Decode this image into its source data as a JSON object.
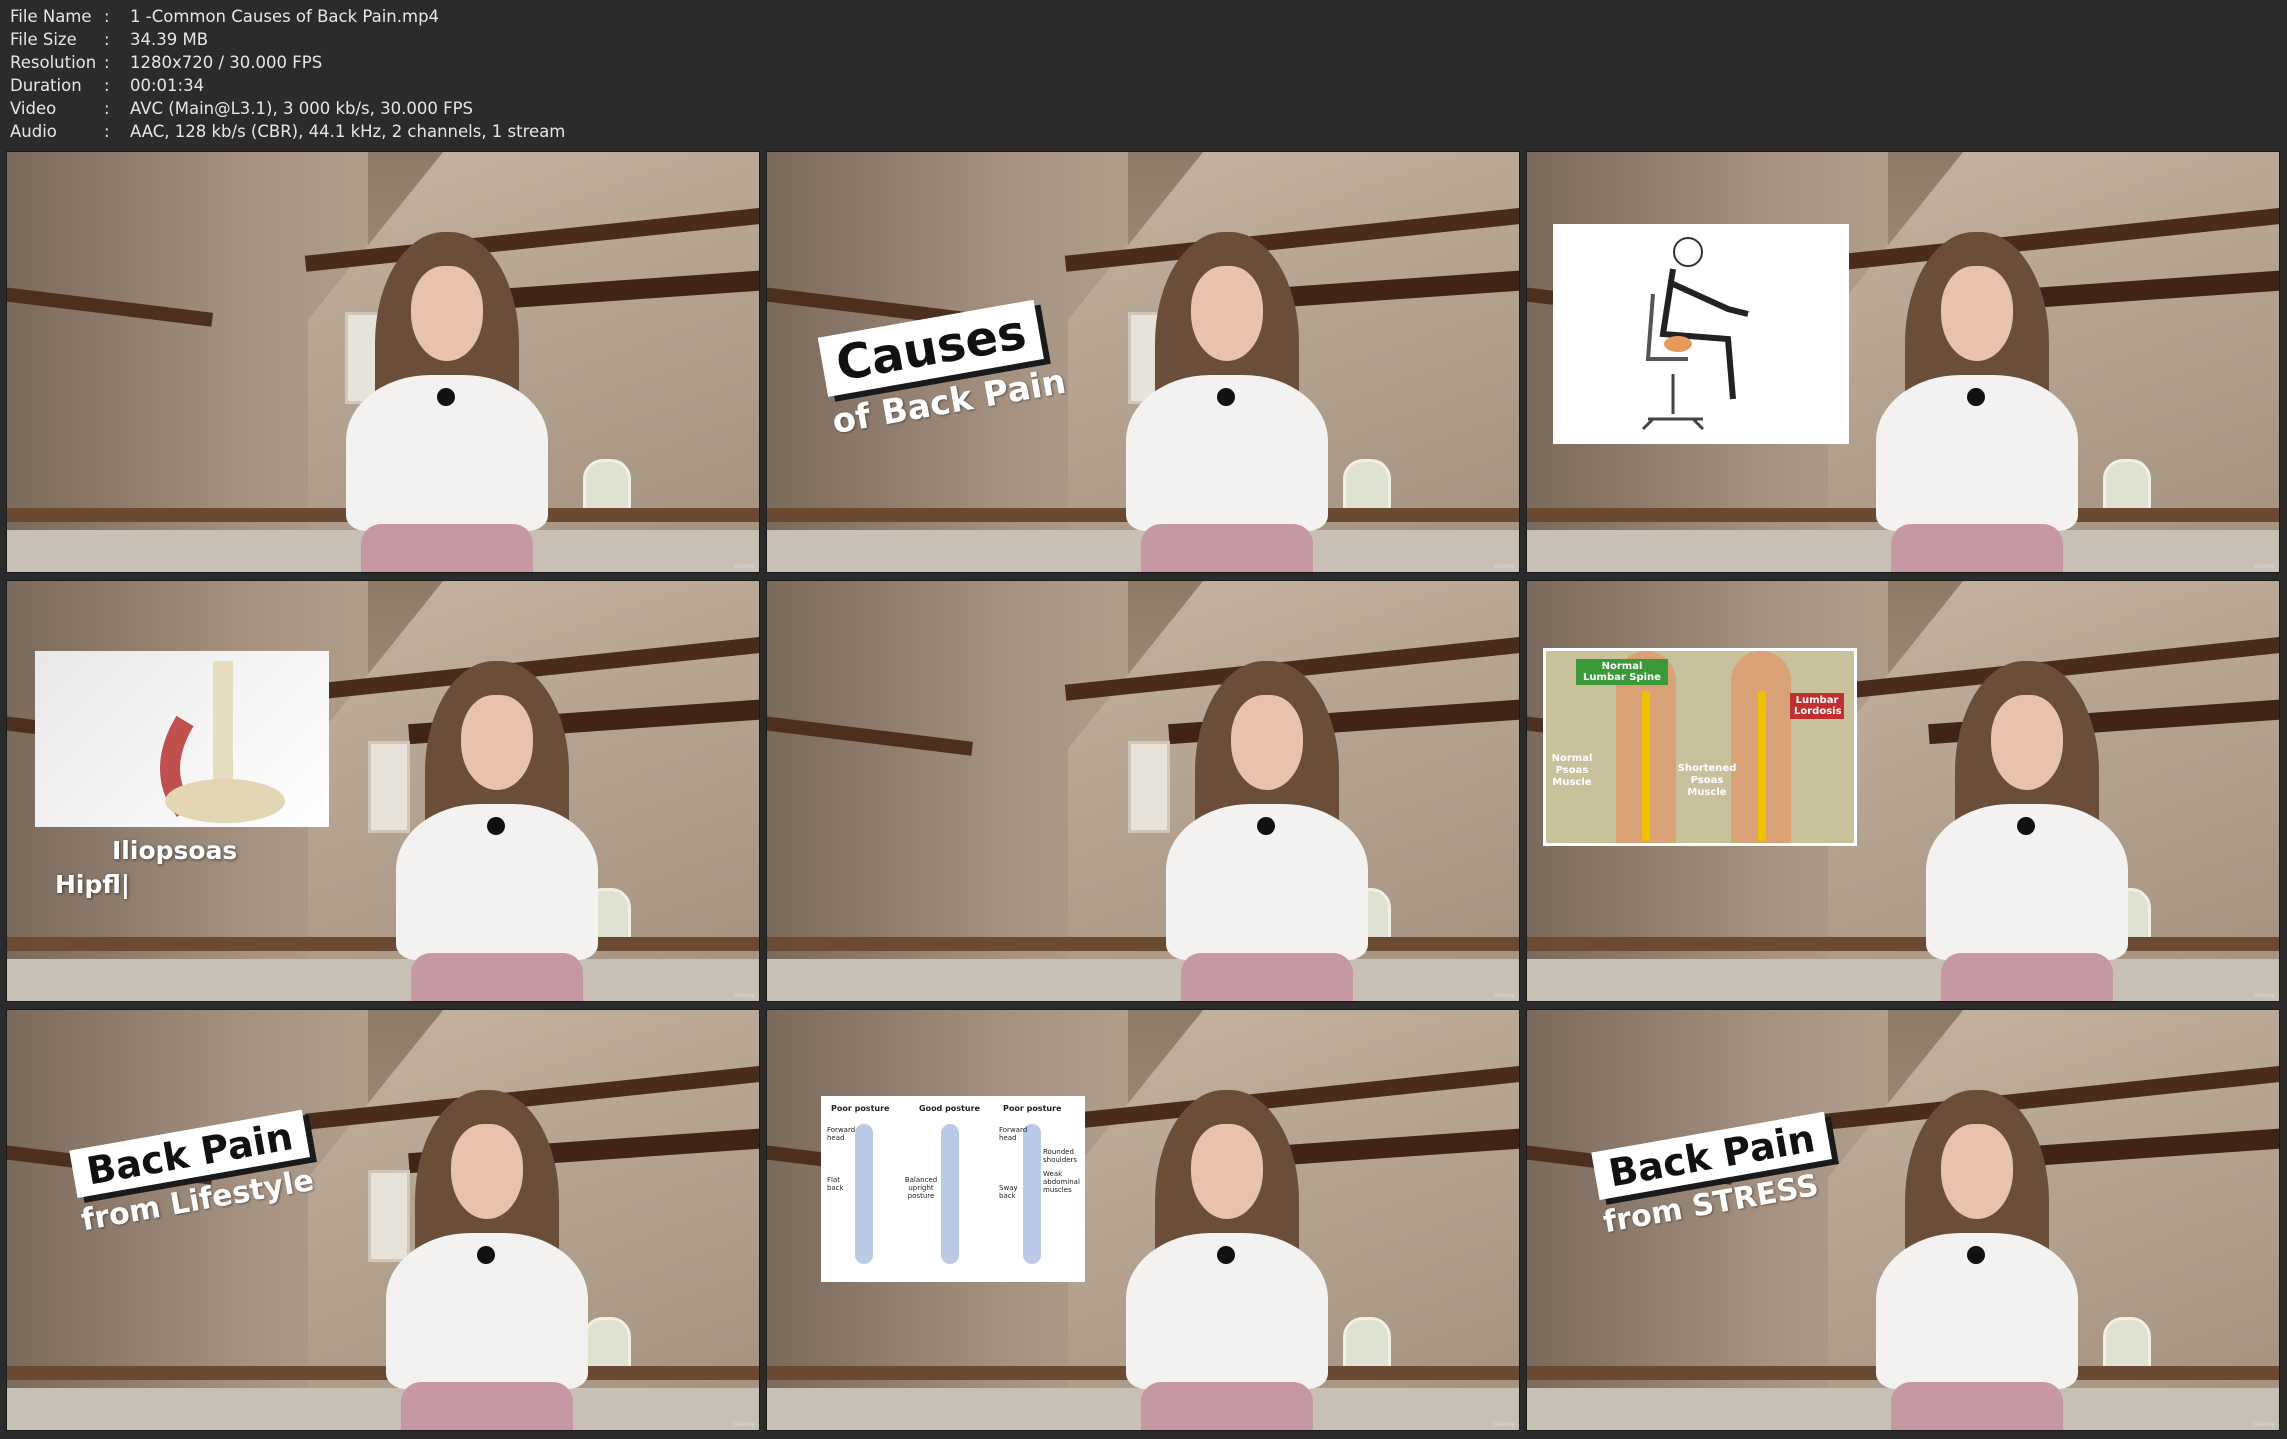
{
  "info": [
    {
      "label": "File Name",
      "sep": ":",
      "value": "1 -Common Causes of Back Pain.mp4"
    },
    {
      "label": "File Size",
      "sep": ":",
      "value": "34.39 MB"
    },
    {
      "label": "Resolution",
      "sep": ":",
      "value": "1280x720 / 30.000 FPS"
    },
    {
      "label": "Duration",
      "sep": ":",
      "value": "00:01:34"
    },
    {
      "label": "Video",
      "sep": ":",
      "value": "AVC (Main@L3.1), 3 000 kb/s, 30.000 FPS"
    },
    {
      "label": "Audio",
      "sep": ":",
      "value": "AAC, 128 kb/s (CBR), 44.1 kHz, 2 channels, 1 stream"
    }
  ],
  "watermark": "Udemy",
  "frames": {
    "f2": {
      "title": "Causes",
      "subtitle": "of Back Pain"
    },
    "f4": {
      "label1": "Iliopsoas",
      "label2": "Hipfl|"
    },
    "f6": {
      "normal": "Normal Lumbar Spine",
      "lordosis": "Lumbar Lordosis",
      "normal_psoas": "Normal Psoas Muscle",
      "short_psoas": "Shortened Psoas Muscle"
    },
    "f7": {
      "title": "Back Pain",
      "subtitle": "from Lifestyle"
    },
    "f8": {
      "poor1": "Poor posture",
      "good": "Good posture",
      "poor2": "Poor posture",
      "fwd": "Forward head",
      "flat": "Flat back",
      "balanced": "Balanced upright posture",
      "fwd2": "Forward head",
      "rounded": "Rounded shoulders",
      "weak": "Weak abdominal muscles",
      "sway": "Sway back"
    },
    "f9": {
      "title": "Back Pain",
      "subtitle": "from STRESS"
    }
  }
}
